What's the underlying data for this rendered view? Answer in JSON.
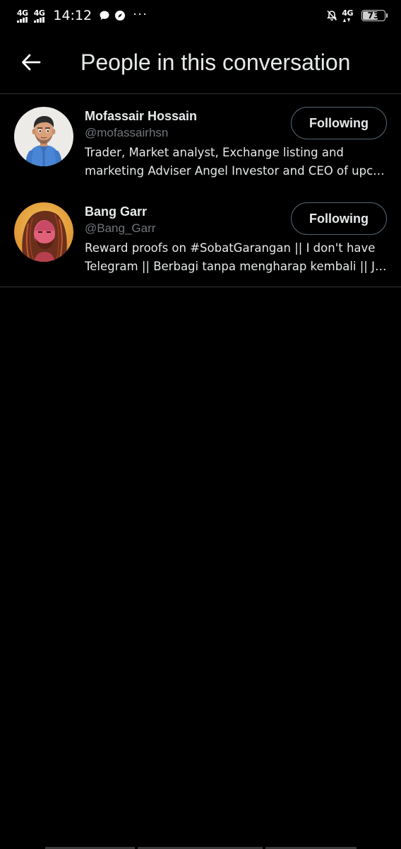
{
  "status_bar": {
    "signal_1": "4G",
    "signal_2": "4G",
    "time": "14:12",
    "more": "···",
    "network_right": "4G",
    "battery_level": 73,
    "battery_text": "73"
  },
  "header": {
    "title": "People in this conversation",
    "back_icon": "arrow-left-icon"
  },
  "people": [
    {
      "name": "Mofassair Hossain",
      "handle": "@mofassairhsn",
      "bio_line_1": "Trader, Market analyst, Exchange listing and",
      "bio_line_2": "marketing Adviser Angel Investor and CEO of upcoming projects",
      "button": "Following"
    },
    {
      "name": "Bang Garr",
      "handle": "@Bang_Garr",
      "bio_line_1": "Reward proofs on #SobatGarangan || I don't have",
      "bio_line_2": "Telegram || Berbagi tanpa mengharap kembali || Join",
      "button": "Following"
    }
  ],
  "colors": {
    "background": "#000000",
    "text": "#e7e9ea",
    "secondary_text": "#71767b",
    "divider": "#2f3336",
    "button_border": "#536471"
  }
}
